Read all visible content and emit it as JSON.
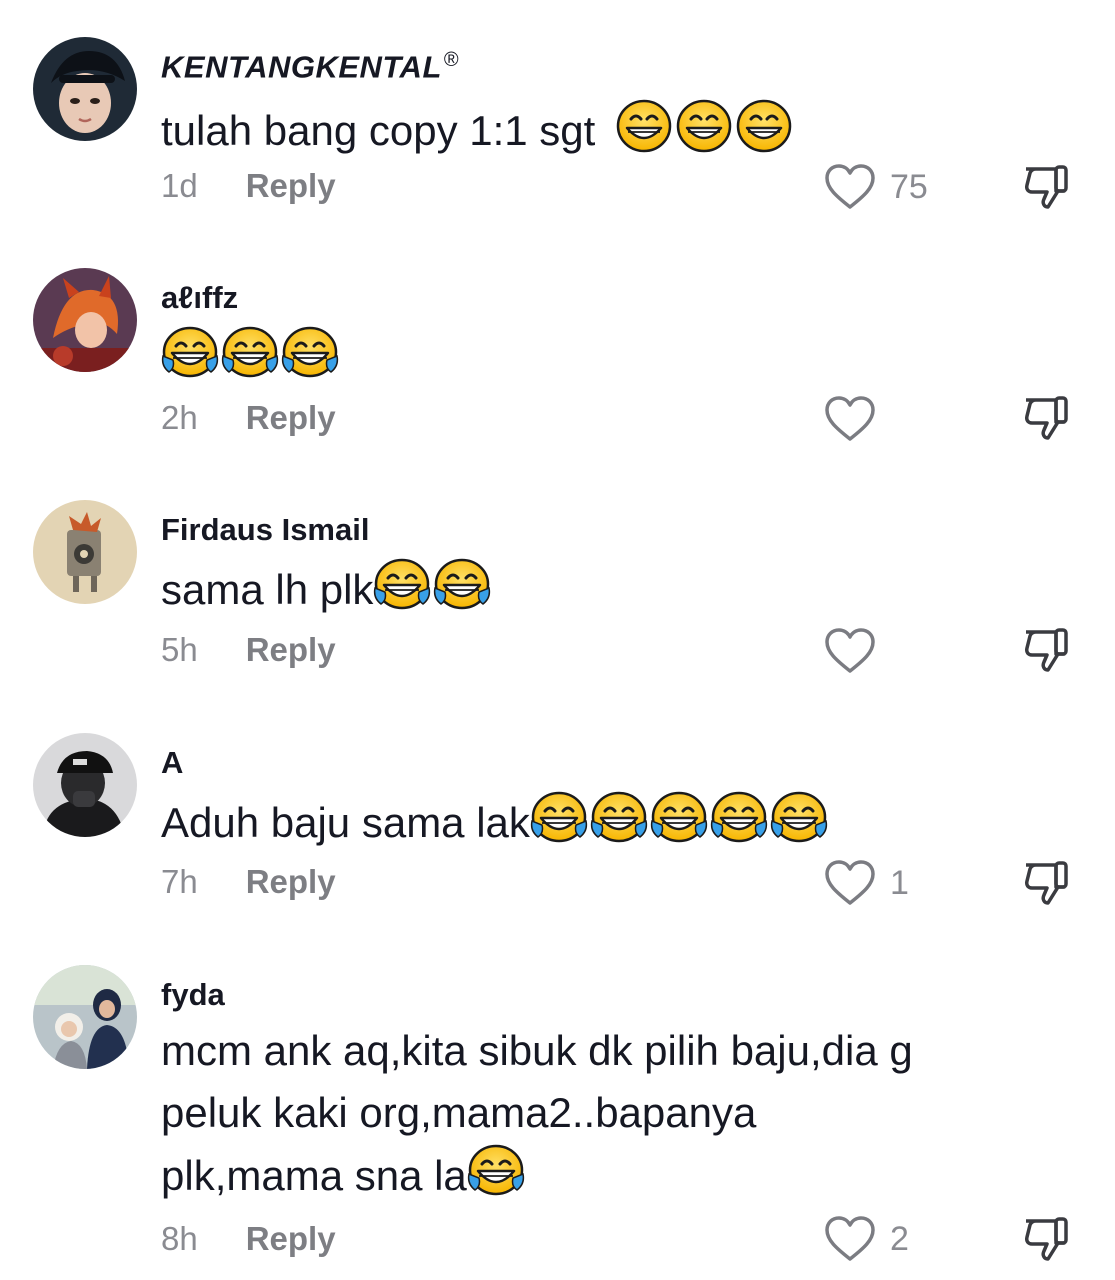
{
  "comments": [
    {
      "username": "KENTANGKENTAL",
      "username_suffix": "®",
      "text": "tulah bang copy 1:1 sgt",
      "emoji": [
        "grinning-squint",
        "grinning-squint",
        "grinning-squint"
      ],
      "time": "1d",
      "reply_label": "Reply",
      "like_count": "75"
    },
    {
      "username": "aℓıffz",
      "text": "",
      "emoji": [
        "tears-of-joy",
        "tears-of-joy",
        "tears-of-joy"
      ],
      "time": "2h",
      "reply_label": "Reply",
      "like_count": ""
    },
    {
      "username": "Firdaus Ismail",
      "text": "sama lh plk",
      "emoji": [
        "tears-of-joy",
        "tears-of-joy"
      ],
      "time": "5h",
      "reply_label": "Reply",
      "like_count": ""
    },
    {
      "username": "A",
      "text": "Aduh baju sama lak",
      "emoji": [
        "tears-of-joy",
        "tears-of-joy",
        "tears-of-joy",
        "tears-of-joy",
        "tears-of-joy"
      ],
      "time": "7h",
      "reply_label": "Reply",
      "like_count": "1"
    },
    {
      "username": "fyda",
      "text_lines": [
        "mcm ank aq,kita sibuk dk pilih baju,dia g",
        "peluk kaki org,mama2..bapanya",
        "plk,mama sna la"
      ],
      "emoji": [
        "tears-of-joy"
      ],
      "time": "8h",
      "reply_label": "Reply",
      "like_count": "2"
    }
  ],
  "icons": {
    "like": "heart-outline-icon",
    "dislike": "thumbs-down-outline-icon"
  }
}
